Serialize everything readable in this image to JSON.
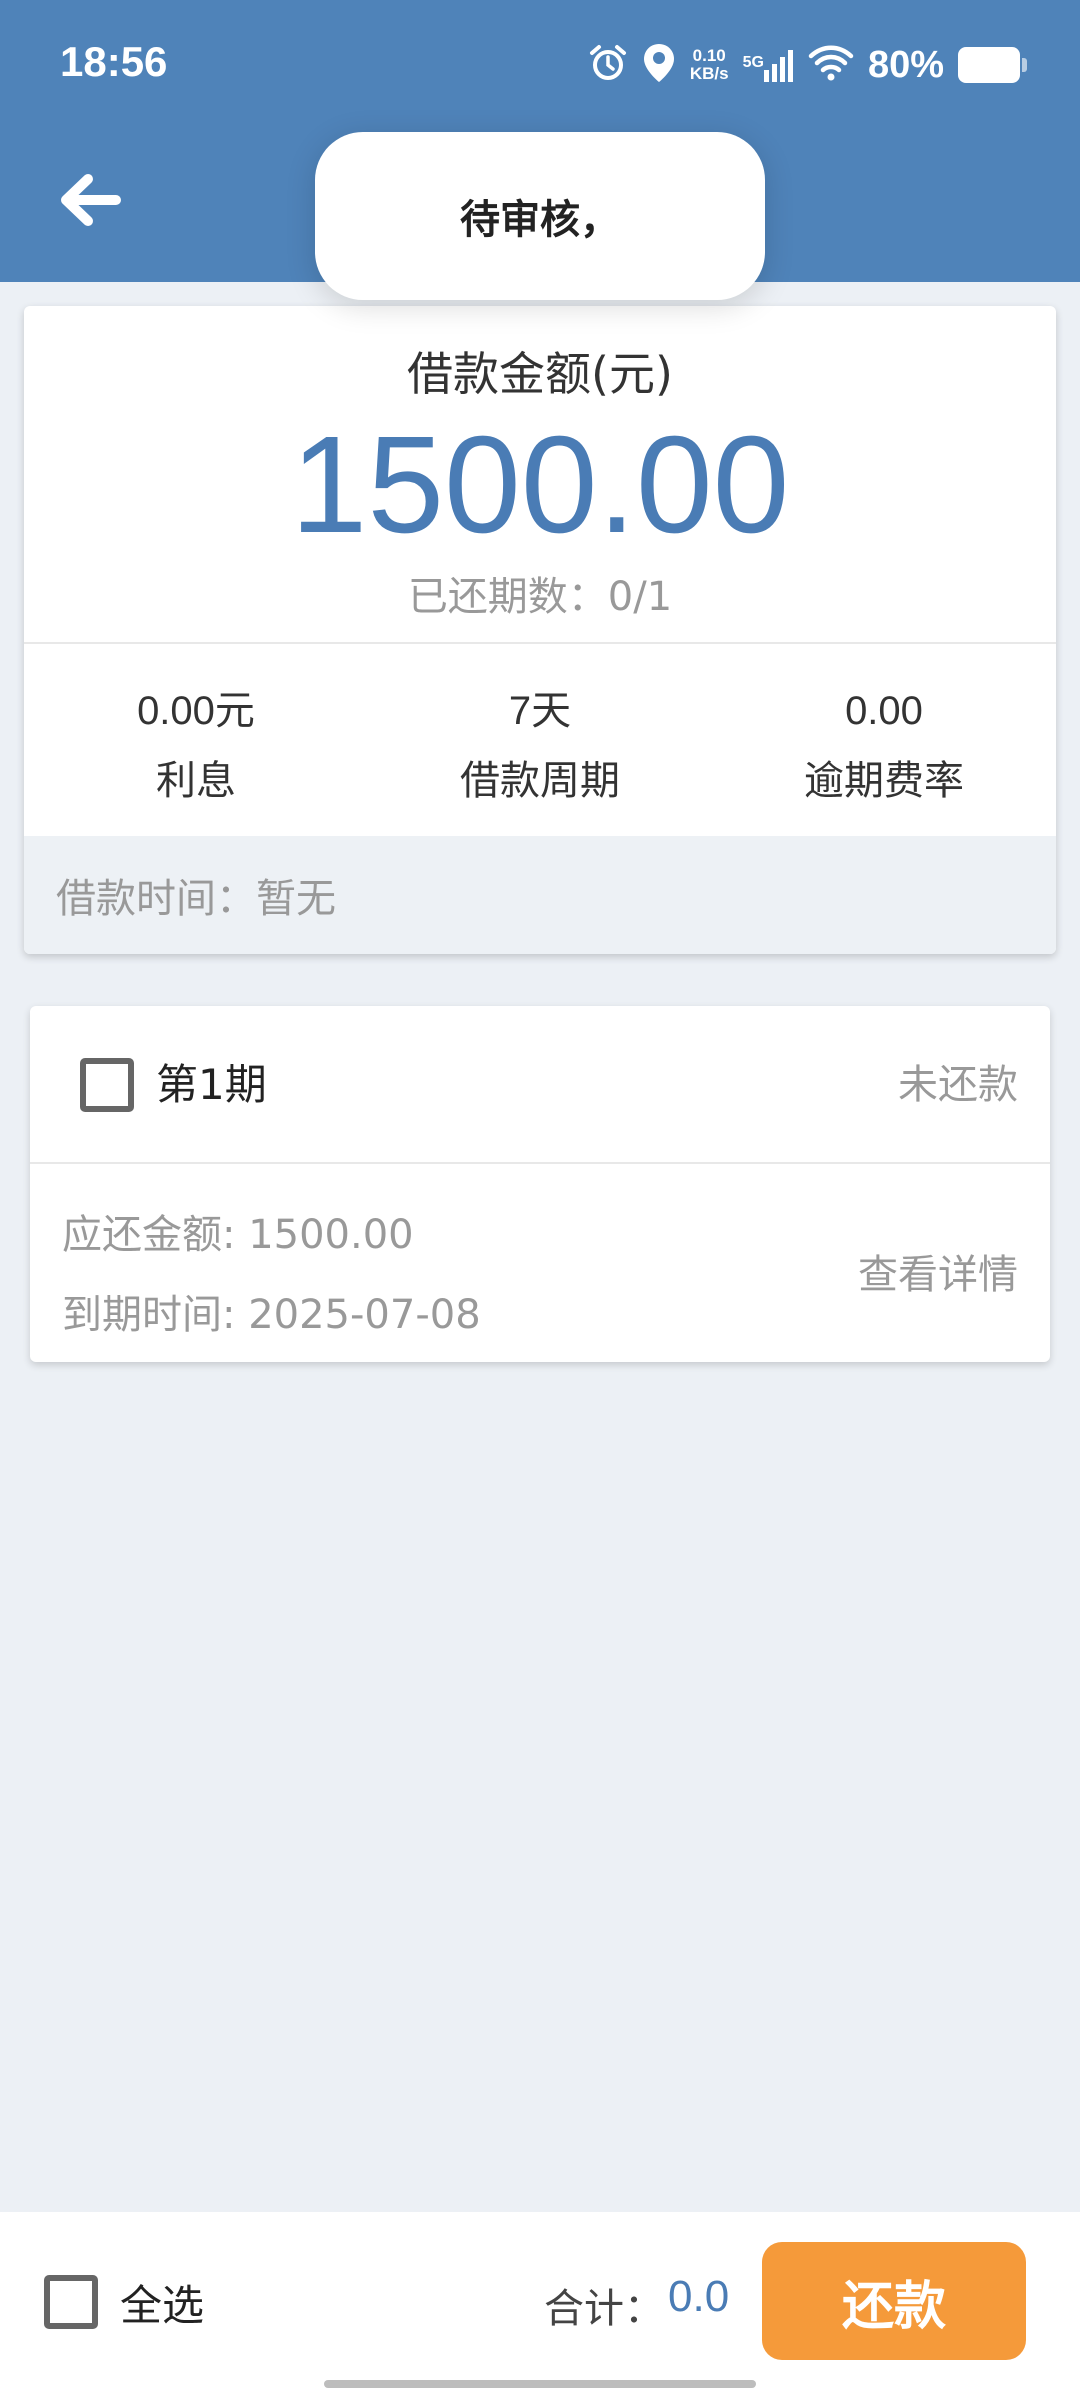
{
  "status_bar": {
    "time": "18:56",
    "net_speed_value": "0.10",
    "net_speed_unit": "KB/s",
    "network_type": "5G",
    "battery": "80%",
    "icons": [
      "alarm-icon",
      "location-icon",
      "signal-icon",
      "wifi-icon",
      "battery-icon"
    ]
  },
  "toast": {
    "message": "待审核，"
  },
  "summary": {
    "amount_label": "借款金额(元)",
    "amount_value": "1500.00",
    "periods_paid": "已还期数：0/1",
    "stats": [
      {
        "value": "0.00元",
        "label": "利息"
      },
      {
        "value": "7天",
        "label": "借款周期"
      },
      {
        "value": "0.00",
        "label": "逾期费率"
      }
    ],
    "loan_time": "借款时间：暂无"
  },
  "installments": [
    {
      "title": "第1期",
      "status": "未还款",
      "amount": "应还金额: 1500.00",
      "due": "到期时间: 2025-07-08",
      "detail_link": "查看详情",
      "checked": false
    }
  ],
  "bottom_bar": {
    "select_all": "全选",
    "total_label": "合计：",
    "total_value": "0.0",
    "repay_button": "还款"
  },
  "colors": {
    "header": "#4f83b9",
    "accent_blue": "#4a7cb5",
    "repay_orange": "#f59a3a",
    "background": "#ecf0f5"
  }
}
